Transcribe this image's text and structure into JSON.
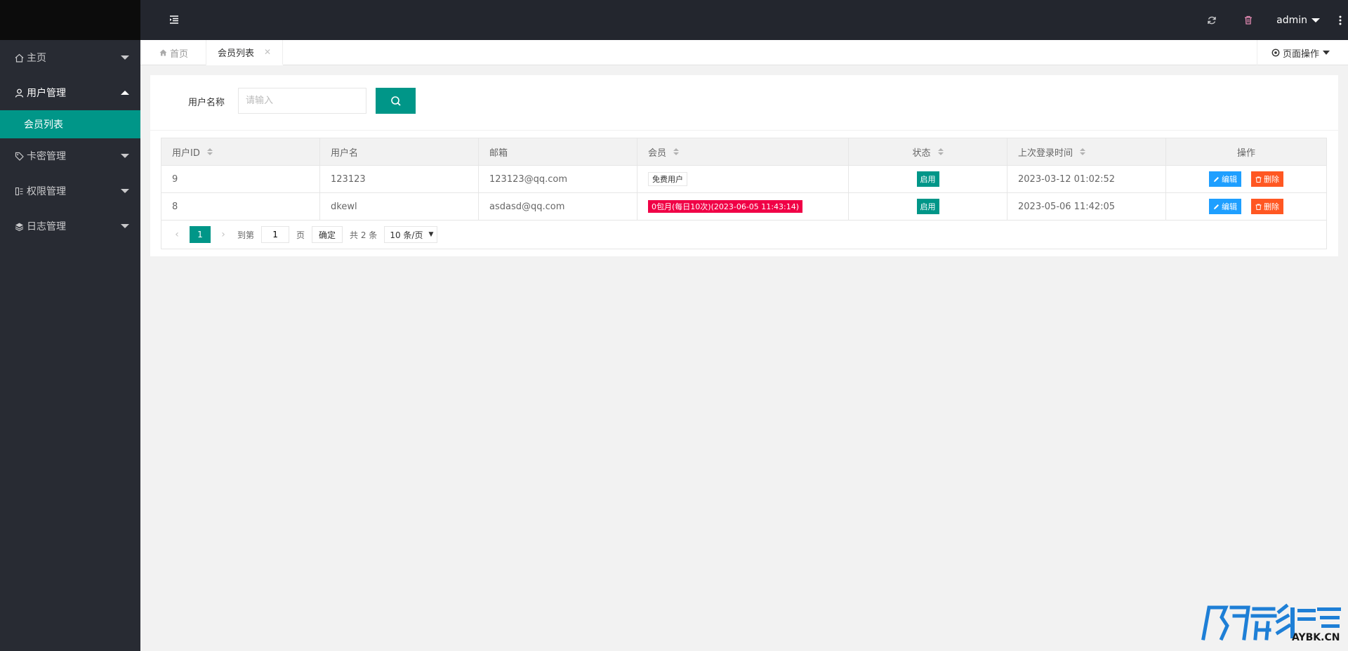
{
  "sidebar": {
    "items": [
      {
        "label": "主页"
      },
      {
        "label": "用户管理"
      },
      {
        "label": "卡密管理"
      },
      {
        "label": "权限管理"
      },
      {
        "label": "日志管理"
      }
    ],
    "subitems": [
      {
        "label": "会员列表"
      }
    ]
  },
  "header": {
    "user": "admin"
  },
  "tabs": {
    "home": "首页",
    "active": "会员列表",
    "page_ops": "页面操作"
  },
  "search": {
    "label": "用户名称",
    "placeholder": "请输入"
  },
  "table": {
    "headers": [
      "用户ID",
      "用户名",
      "邮箱",
      "会员",
      "状态",
      "上次登录时间",
      "操作"
    ],
    "rows": [
      {
        "id": "9",
        "username": "123123",
        "email": "123123@qq.com",
        "member": "免费用户",
        "status": "启用",
        "last_login": "2023-03-12 01:02:52",
        "edit": "编辑",
        "delete": "删除"
      },
      {
        "id": "8",
        "username": "dkewl",
        "email": "asdasd@qq.com",
        "member": "0包月(每日10次)(2023-06-05 11:43:14)",
        "status": "启用",
        "last_login": "2023-05-06 11:42:05",
        "edit": "编辑",
        "delete": "删除"
      }
    ]
  },
  "pager": {
    "current": "1",
    "goto_label": "到第",
    "goto_value": "1",
    "page_unit": "页",
    "confirm": "确定",
    "total": "共 2 条",
    "page_size": "10 条/页"
  },
  "colors": {
    "primary": "#009688",
    "sidebar_bg": "#282b33",
    "header_bg": "#23262e",
    "edit": "#1e9fff",
    "delete": "#ff5722",
    "vip": "#f00046"
  }
}
